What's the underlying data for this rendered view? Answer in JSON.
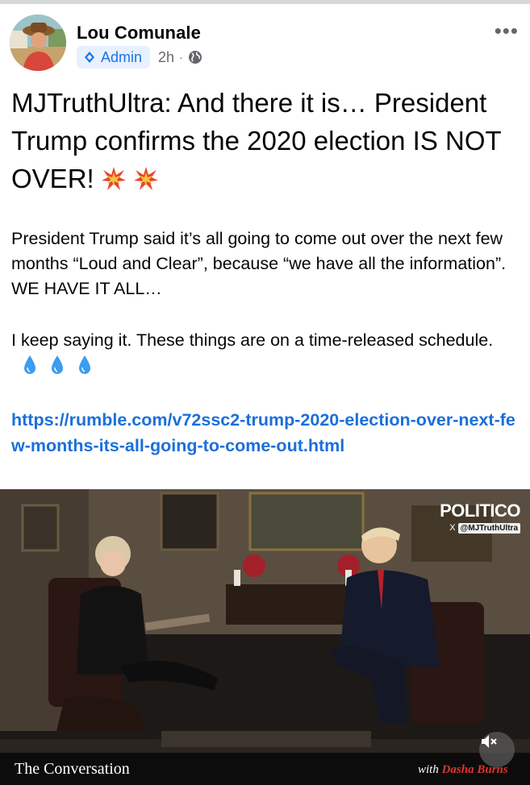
{
  "post": {
    "author": "Lou Comunale",
    "badge_label": "Admin",
    "time": "2h",
    "separator": "·",
    "more_label": "•••",
    "headline": "MJTruthUltra: And there it is… President Trump confirms the 2020 election IS NOT OVER!",
    "paragraph1": "President Trump said it’s all going to come out over the next few months “Loud and Clear”, because “we have all the information”. WE HAVE IT ALL…",
    "paragraph2": "I keep saying it. These things are on a time-released schedule.",
    "link_text": "https://rumble.com/v72ssc2-trump-2020-election-over-next-few-months-its-all-going-to-come-out.html",
    "accent_color": "#1a6fdb"
  },
  "video": {
    "watermark_logo": "POLITICO",
    "watermark_x": "X",
    "watermark_handle": "@MJTruthUltra",
    "show_title": "The Conversation",
    "with_label": "with",
    "with_name": "Dasha Burns",
    "mute_icon": "speaker-muted-icon"
  }
}
